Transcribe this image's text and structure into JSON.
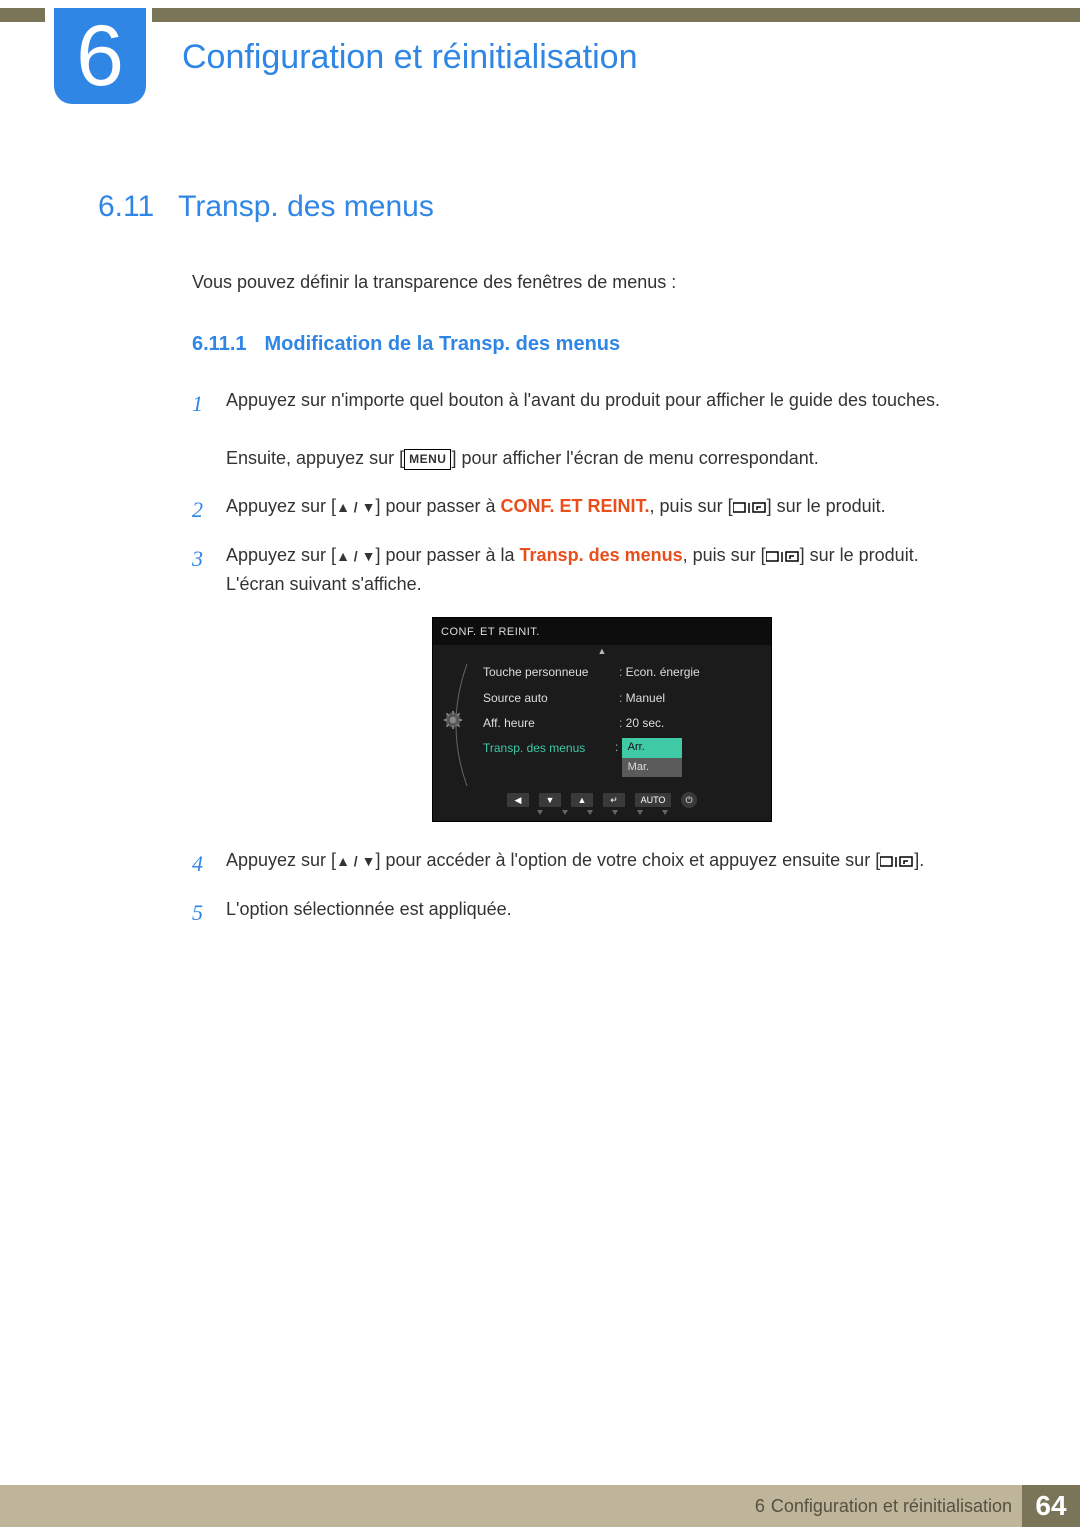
{
  "chapter": {
    "number": "6",
    "title": "Configuration et réinitialisation"
  },
  "section": {
    "number": "6.11",
    "title": "Transp. des menus"
  },
  "intro": "Vous pouvez définir la transparence des fenêtres de menus :",
  "subsection": {
    "number": "6.11.1",
    "title": "Modification de la Transp. des menus"
  },
  "steps": {
    "s1a": "Appuyez sur n'importe quel bouton à l'avant du produit pour afficher le guide des touches.",
    "s1b_pre": "Ensuite, appuyez sur [",
    "s1b_menu": "MENU",
    "s1b_post": "] pour afficher l'écran de menu correspondant.",
    "s2_pre": "Appuyez sur [",
    "ud": "▲ / ▼",
    "s2_mid": "] pour passer à ",
    "s2_conf": "CONF. ET REINIT.",
    "s2_post": ", puis sur [",
    "s2_end": "] sur le produit.",
    "s3_pre": "Appuyez sur [",
    "s3_mid": "] pour passer à la ",
    "s3_transp": "Transp. des menus",
    "s3_post": ", puis sur [",
    "s3_end": "] sur le produit.",
    "s3_line2": "L'écran suivant s'affiche.",
    "s4_pre": "Appuyez sur [",
    "s4_mid": "] pour accéder à l'option de votre choix et appuyez ensuite sur [",
    "s4_end": "].",
    "s5": "L'option sélectionnée est appliquée."
  },
  "osd": {
    "title": "CONF. ET REINIT.",
    "rows": [
      {
        "label": "Touche personneue",
        "value": "Econ. énergie"
      },
      {
        "label": "Source auto",
        "value": "Manuel"
      },
      {
        "label": "Aff. heure",
        "value": "20 sec."
      }
    ],
    "active_label": "Transp. des menus",
    "options": {
      "selected": "Arr.",
      "other": "Mar."
    },
    "auto": "AUTO"
  },
  "footer": {
    "chapter_num": "6",
    "chapter_title": "Configuration et réinitialisation",
    "page": "64"
  }
}
